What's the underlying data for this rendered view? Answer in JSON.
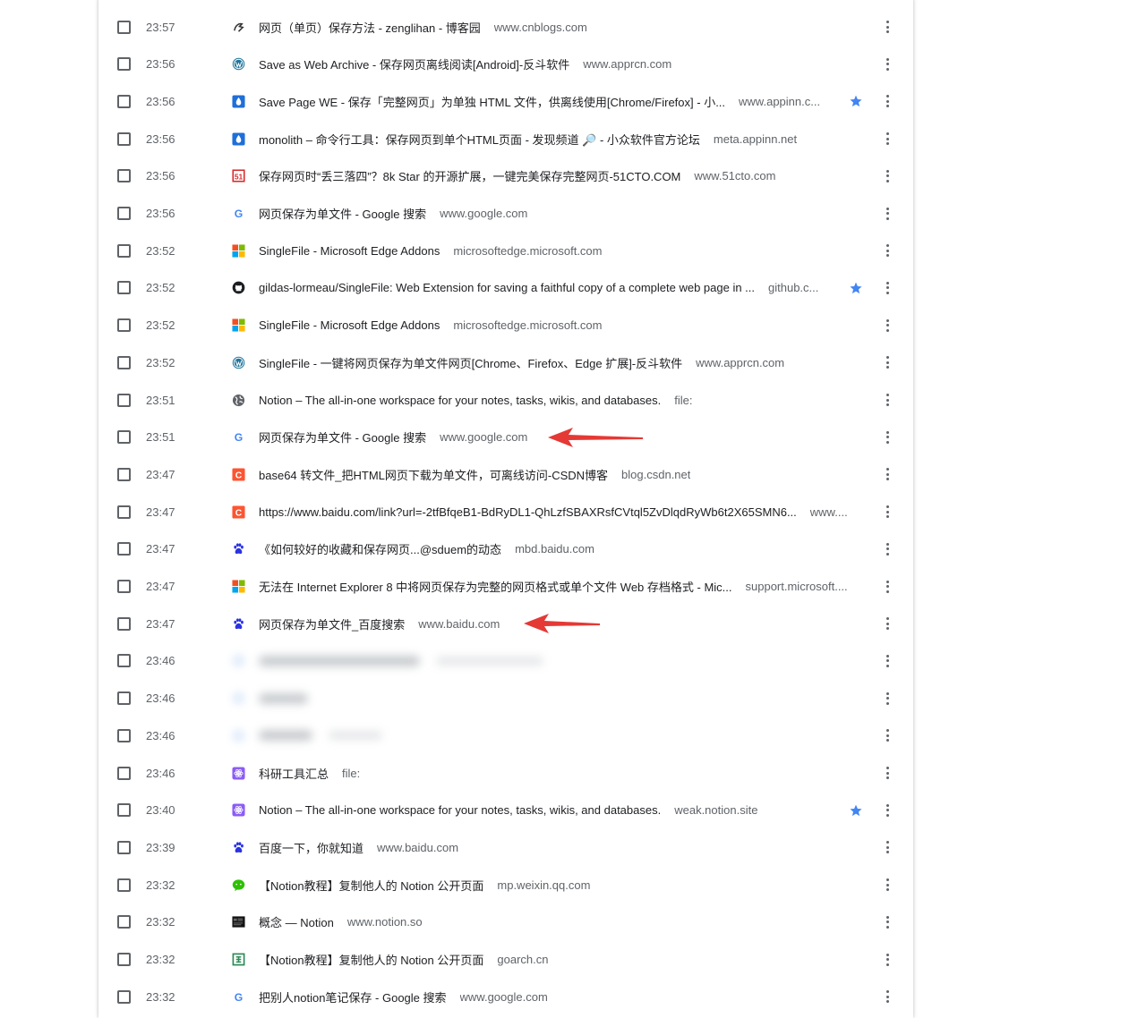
{
  "rows": [
    {
      "time": "23:57",
      "title": "网页（单页）保存方法 - zenglihan - 博客园",
      "domain": "www.cnblogs.com",
      "icon": "cnblogs-icon",
      "starred": false
    },
    {
      "time": "23:56",
      "title": "Save as Web Archive - 保存网页离线阅读[Android]-反斗软件",
      "domain": "www.apprcn.com",
      "icon": "wordpress-icon",
      "starred": false
    },
    {
      "time": "23:56",
      "title": "Save Page WE - 保存「完整网页」为单独 HTML 文件，供离线使用[Chrome/Firefox] - 小...",
      "domain": "www.appinn.c...",
      "icon": "appinn-icon",
      "starred": true
    },
    {
      "time": "23:56",
      "title": "monolith – 命令行工具：保存网页到单个HTML页面 - 发现频道 🔎 - 小众软件官方论坛",
      "domain": "meta.appinn.net",
      "icon": "appinn-icon",
      "starred": false
    },
    {
      "time": "23:56",
      "title": "保存网页时“丢三落四”？8k Star 的开源扩展，一键完美保存完整网页-51CTO.COM",
      "domain": "www.51cto.com",
      "icon": "51cto-icon",
      "starred": false
    },
    {
      "time": "23:56",
      "title": "网页保存为单文件 - Google 搜索",
      "domain": "www.google.com",
      "icon": "google-icon",
      "starred": false
    },
    {
      "time": "23:52",
      "title": "SingleFile - Microsoft Edge Addons",
      "domain": "microsoftedge.microsoft.com",
      "icon": "microsoft-icon",
      "starred": false
    },
    {
      "time": "23:52",
      "title": "gildas-lormeau/SingleFile: Web Extension for saving a faithful copy of a complete web page in ...",
      "domain": "github.c...",
      "icon": "github-icon",
      "starred": true
    },
    {
      "time": "23:52",
      "title": "SingleFile - Microsoft Edge Addons",
      "domain": "microsoftedge.microsoft.com",
      "icon": "microsoft-icon",
      "starred": false
    },
    {
      "time": "23:52",
      "title": "SingleFile - 一键将网页保存为单文件网页[Chrome、Firefox、Edge 扩展]-反斗软件",
      "domain": "www.apprcn.com",
      "icon": "wordpress-icon",
      "starred": false
    },
    {
      "time": "23:51",
      "title": "Notion – The all-in-one workspace for your notes, tasks, wikis, and databases.",
      "domain": "file:",
      "icon": "globe-icon",
      "starred": false
    },
    {
      "time": "23:51",
      "title": "网页保存为单文件 - Google 搜索",
      "domain": "www.google.com",
      "icon": "google-icon",
      "starred": false
    },
    {
      "time": "23:47",
      "title": "base64 转文件_把HTML网页下载为单文件，可离线访问-CSDN博客",
      "domain": "blog.csdn.net",
      "icon": "csdn-icon",
      "starred": false
    },
    {
      "time": "23:47",
      "title": "https://www.baidu.com/link?url=-2tfBfqeB1-BdRyDL1-QhLzfSBAXRsfCVtql5ZvDlqdRyWb6t2X65SMN6...",
      "domain": "www....",
      "icon": "csdn-icon",
      "starred": false
    },
    {
      "time": "23:47",
      "title": "《如何较好的收藏和保存网页...@sduem的动态",
      "domain": "mbd.baidu.com",
      "icon": "baidu-icon",
      "starred": false
    },
    {
      "time": "23:47",
      "title": "无法在 Internet Explorer 8 中将网页保存为完整的网页格式或单个文件 Web 存档格式 - Mic...",
      "domain": "support.microsoft....",
      "icon": "microsoft-icon",
      "starred": false
    },
    {
      "time": "23:47",
      "title": "网页保存为单文件_百度搜索",
      "domain": "www.baidu.com",
      "icon": "baidu-icon",
      "starred": false
    },
    {
      "time": "23:46",
      "title": "",
      "domain": "",
      "icon": "blurred-icon",
      "starred": false,
      "blurred": true
    },
    {
      "time": "23:46",
      "title": "",
      "domain": "",
      "icon": "blurred-icon",
      "starred": false,
      "blurred": true
    },
    {
      "time": "23:46",
      "title": "",
      "domain": "",
      "icon": "blurred-icon",
      "starred": false,
      "blurred": true
    },
    {
      "time": "23:46",
      "title": "科研工具汇总",
      "domain": "file:",
      "icon": "purple-app-icon",
      "starred": false
    },
    {
      "time": "23:40",
      "title": "Notion – The all-in-one workspace for your notes, tasks, wikis, and databases.",
      "domain": "weak.notion.site",
      "icon": "purple-app-icon",
      "starred": true
    },
    {
      "time": "23:39",
      "title": "百度一下，你就知道",
      "domain": "www.baidu.com",
      "icon": "baidu-icon",
      "starred": false
    },
    {
      "time": "23:32",
      "title": "【Notion教程】复制他人的 Notion 公开页面",
      "domain": "mp.weixin.qq.com",
      "icon": "wechat-icon",
      "starred": false
    },
    {
      "time": "23:32",
      "title": "概念 — Notion",
      "domain": "www.notion.so",
      "icon": "notion-icon",
      "starred": false
    },
    {
      "time": "23:32",
      "title": "【Notion教程】复制他人的 Notion 公开页面",
      "domain": "goarch.cn",
      "icon": "goarch-icon",
      "starred": false
    },
    {
      "time": "23:32",
      "title": "把别人notion笔记保存 - Google 搜索",
      "domain": "www.google.com",
      "icon": "google-icon",
      "starred": false
    }
  ],
  "annotations": [
    {
      "icon": "red-arrow",
      "row": 11
    },
    {
      "icon": "red-arrow",
      "row": 16
    }
  ],
  "colors": {
    "star": "#4285f4",
    "arrow": "#e53935",
    "text": "#202124",
    "secondary": "#5f6368"
  }
}
